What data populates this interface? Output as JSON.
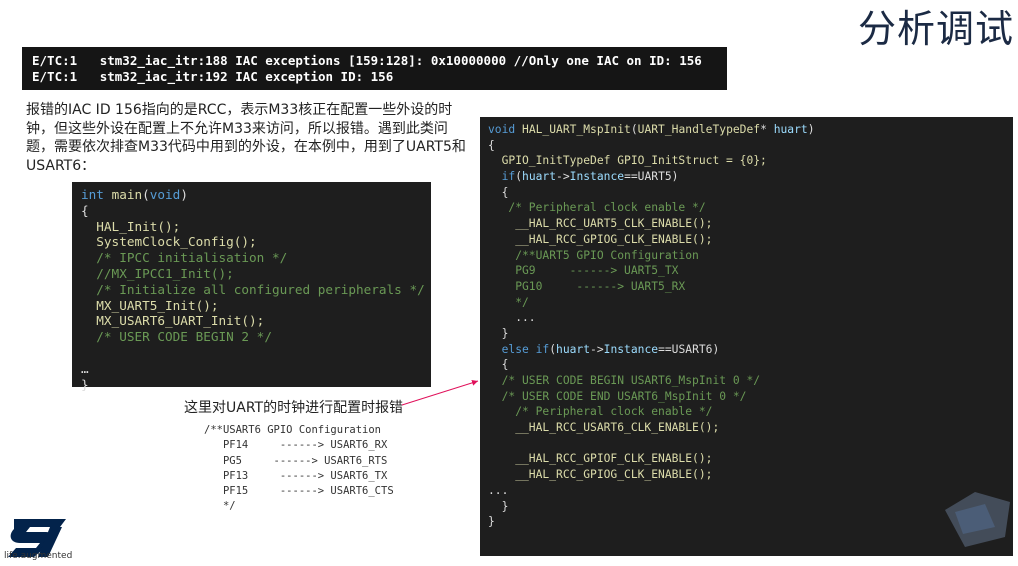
{
  "slide_title": "分析调试",
  "log_lines": [
    "E/TC:1   stm32_iac_itr:188 IAC exceptions [159:128]: 0x10000000 //Only one IAC on ID: 156",
    "E/TC:1   stm32_iac_itr:192 IAC exception ID: 156"
  ],
  "description": "报错的IAC ID 156指向的是RCC，表示M33核正在配置一些外设的时钟，但这些外设在配置上不允许M33来访问，所以报错。遇到此类问题，需要依次排查M33代码中用到的外设，在本例中，用到了UART5和USART6：",
  "main_code": [
    {
      "segs": [
        {
          "t": "int ",
          "c": "kw"
        },
        {
          "t": "main",
          "c": "fn"
        },
        {
          "t": "(",
          "c": "pl"
        },
        {
          "t": "void",
          "c": "kw"
        },
        {
          "t": ")",
          "c": "pl"
        }
      ]
    },
    {
      "segs": [
        {
          "t": "{",
          "c": "pl"
        }
      ]
    },
    {
      "segs": [
        {
          "t": "  HAL_Init();",
          "c": "fn"
        }
      ]
    },
    {
      "segs": [
        {
          "t": "  SystemClock_Config();",
          "c": "fn"
        }
      ]
    },
    {
      "segs": [
        {
          "t": "  /* IPCC initialisation */",
          "c": "cm"
        }
      ]
    },
    {
      "segs": [
        {
          "t": "  //MX_IPCC1_Init();",
          "c": "cm"
        }
      ]
    },
    {
      "segs": [
        {
          "t": "  /* Initialize all configured peripherals */",
          "c": "cm"
        }
      ]
    },
    {
      "segs": [
        {
          "t": "  MX_UART5_Init();",
          "c": "fn"
        }
      ]
    },
    {
      "segs": [
        {
          "t": "  MX_USART6_UART_Init();",
          "c": "fn"
        }
      ]
    },
    {
      "segs": [
        {
          "t": "  /* USER CODE BEGIN 2 */",
          "c": "cm"
        }
      ]
    },
    {
      "segs": [
        {
          "t": "",
          "c": "pl"
        }
      ]
    },
    {
      "segs": [
        {
          "t": "…",
          "c": "pl"
        }
      ]
    },
    {
      "segs": [
        {
          "t": "}",
          "c": "pl"
        }
      ]
    }
  ],
  "msp_code": [
    {
      "segs": [
        {
          "t": "void ",
          "c": "kw"
        },
        {
          "t": "HAL_UART_MspInit",
          "c": "fn"
        },
        {
          "t": "(",
          "c": "pl"
        },
        {
          "t": "UART_HandleTypeDef",
          "c": "fn"
        },
        {
          "t": "* ",
          "c": "pl"
        },
        {
          "t": "huart",
          "c": "vr"
        },
        {
          "t": ")",
          "c": "pl"
        }
      ]
    },
    {
      "segs": [
        {
          "t": "{",
          "c": "pl"
        }
      ]
    },
    {
      "segs": [
        {
          "t": "  GPIO_InitTypeDef GPIO_InitStruct = {0};",
          "c": "fn"
        }
      ]
    },
    {
      "segs": [
        {
          "t": "  if",
          "c": "kw"
        },
        {
          "t": "(",
          "c": "pl"
        },
        {
          "t": "huart",
          "c": "vr"
        },
        {
          "t": "->",
          "c": "pl"
        },
        {
          "t": "Instance",
          "c": "vr"
        },
        {
          "t": "==UART5)",
          "c": "pl"
        }
      ]
    },
    {
      "segs": [
        {
          "t": "  {",
          "c": "pl"
        }
      ]
    },
    {
      "segs": [
        {
          "t": "   /* Peripheral clock enable */",
          "c": "cm"
        }
      ]
    },
    {
      "segs": [
        {
          "t": "    __HAL_RCC_UART5_CLK_ENABLE();",
          "c": "fn"
        }
      ]
    },
    {
      "segs": [
        {
          "t": "    __HAL_RCC_GPIOG_CLK_ENABLE();",
          "c": "fn"
        }
      ]
    },
    {
      "segs": [
        {
          "t": "    /**UART5 GPIO Configuration",
          "c": "cm"
        }
      ]
    },
    {
      "segs": [
        {
          "t": "    PG9     ------> UART5_TX",
          "c": "cm"
        }
      ]
    },
    {
      "segs": [
        {
          "t": "    PG10     ------> UART5_RX",
          "c": "cm"
        }
      ]
    },
    {
      "segs": [
        {
          "t": "    */",
          "c": "cm"
        }
      ]
    },
    {
      "segs": [
        {
          "t": "    ...",
          "c": "pl"
        }
      ]
    },
    {
      "segs": [
        {
          "t": "  }",
          "c": "pl"
        }
      ]
    },
    {
      "segs": [
        {
          "t": "  else if",
          "c": "kw"
        },
        {
          "t": "(",
          "c": "pl"
        },
        {
          "t": "huart",
          "c": "vr"
        },
        {
          "t": "->",
          "c": "pl"
        },
        {
          "t": "Instance",
          "c": "vr"
        },
        {
          "t": "==USART6)",
          "c": "pl"
        }
      ]
    },
    {
      "segs": [
        {
          "t": "  {",
          "c": "pl"
        }
      ]
    },
    {
      "segs": [
        {
          "t": "  /* USER CODE BEGIN USART6_MspInit 0 */",
          "c": "cm"
        }
      ]
    },
    {
      "segs": [
        {
          "t": "  /* USER CODE END USART6_MspInit 0 */",
          "c": "cm"
        }
      ]
    },
    {
      "segs": [
        {
          "t": "    /* Peripheral clock enable */",
          "c": "cm"
        }
      ]
    },
    {
      "segs": [
        {
          "t": "    __HAL_RCC_USART6_CLK_ENABLE();",
          "c": "fn"
        }
      ]
    },
    {
      "segs": [
        {
          "t": "",
          "c": "pl"
        }
      ]
    },
    {
      "segs": [
        {
          "t": "    __HAL_RCC_GPIOF_CLK_ENABLE();",
          "c": "fn"
        }
      ]
    },
    {
      "segs": [
        {
          "t": "    __HAL_RCC_GPIOG_CLK_ENABLE();",
          "c": "fn"
        }
      ]
    },
    {
      "segs": [
        {
          "t": "...",
          "c": "pl"
        }
      ]
    },
    {
      "segs": [
        {
          "t": "  }",
          "c": "pl"
        }
      ]
    },
    {
      "segs": [
        {
          "t": "}",
          "c": "pl"
        }
      ]
    }
  ],
  "annotation": "这里对UART的时钟进行配置时报错",
  "gpio_config": [
    "/**USART6 GPIO Configuration",
    "   PF14     ------> USART6_RX",
    "   PG5     ------> USART6_RTS",
    "   PF13     ------> USART6_TX",
    "   PF15     ------> USART6_CTS",
    "   */"
  ],
  "logo_tagline": "life.augmented",
  "colors": {
    "title": "#1b2a44",
    "code_bg": "#1e1e1e",
    "keyword": "#569cd6",
    "function": "#dcdcaa",
    "comment": "#6a9955",
    "arrow": "#e0105a",
    "logo": "#03234b"
  }
}
